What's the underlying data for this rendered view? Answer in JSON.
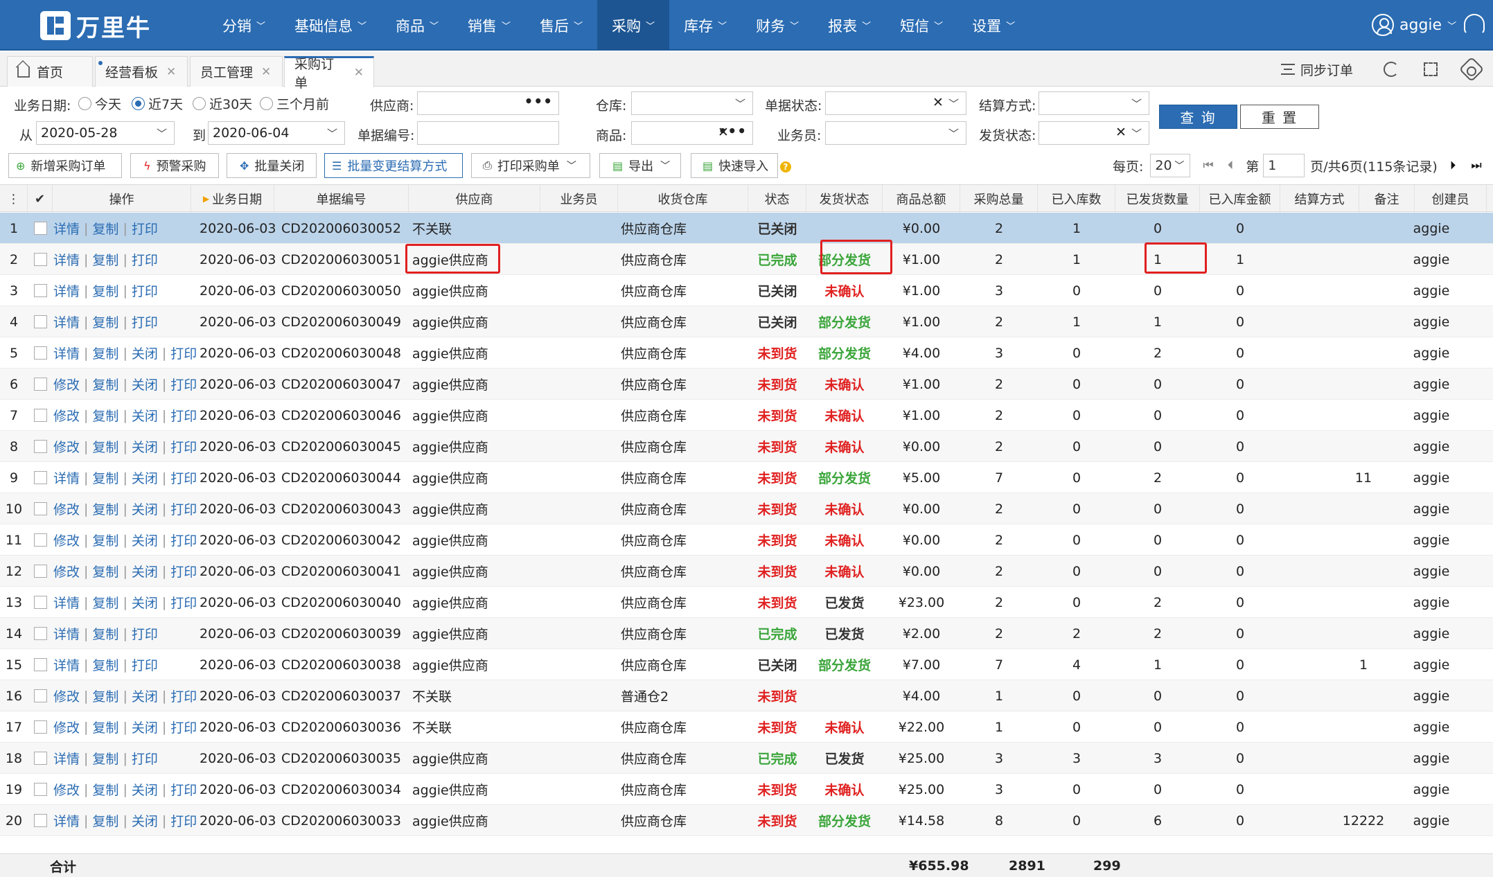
{
  "app": {
    "logo_text": "万里牛"
  },
  "nav": [
    {
      "label": "分销",
      "active": false
    },
    {
      "label": "基础信息",
      "active": false
    },
    {
      "label": "商品",
      "active": false
    },
    {
      "label": "销售",
      "active": false
    },
    {
      "label": "售后",
      "active": false
    },
    {
      "label": "采购",
      "active": true
    },
    {
      "label": "库存",
      "active": false
    },
    {
      "label": "财务",
      "active": false
    },
    {
      "label": "报表",
      "active": false
    },
    {
      "label": "短信",
      "active": false
    },
    {
      "label": "设置",
      "active": false
    }
  ],
  "user": {
    "name": "aggie"
  },
  "tabs": [
    {
      "label": "首页",
      "home": true
    },
    {
      "label": "经营看板"
    },
    {
      "label": "员工管理"
    },
    {
      "label": "采购订单",
      "active": true
    }
  ],
  "tab_tools": {
    "sync_label": "同步订单"
  },
  "filters": {
    "biz_date_label": "业务日期:",
    "date_options": [
      "今天",
      "近7天",
      "近30天",
      "三个月前"
    ],
    "date_selected": "近7天",
    "from_label": "从",
    "from_value": "2020-05-28",
    "to_label": "到",
    "to_value": "2020-06-04",
    "supplier_label": "供应商:",
    "supplier_value": "",
    "doc_no_label": "单据编号:",
    "doc_no_value": "",
    "warehouse_label": "仓库:",
    "warehouse_value": "",
    "product_label": "商品:",
    "product_value": "",
    "doc_status_label": "单据状态:",
    "doc_status_value": "",
    "salesman_label": "业务员:",
    "salesman_value": "",
    "settle_label": "结算方式:",
    "settle_value": "",
    "ship_status_label": "发货状态:",
    "ship_status_value": "",
    "query_label": "查 询",
    "reset_label": "重 置"
  },
  "toolbar": {
    "new_order": "新增采购订单",
    "alert_purchase": "预警采购",
    "batch_close": "批量关闭",
    "batch_settle": "批量变更结算方式",
    "print": "打印采购单",
    "export": "导出",
    "quick_import": "快速导入"
  },
  "pager": {
    "per_page_label": "每页:",
    "per_page": "20",
    "page_prefix": "第",
    "page": "1",
    "page_suffix": "页/共6页(115条记录)"
  },
  "columns": [
    "操作",
    "业务日期",
    "单据编号",
    "供应商",
    "业务员",
    "收货仓库",
    "状态",
    "发货状态",
    "商品总额",
    "采购总量",
    "已入库数",
    "已发货数量",
    "已入库金额",
    "结算方式",
    "备注",
    "创建员"
  ],
  "rows": [
    {
      "n": "1",
      "ops": [
        "详情",
        "复制",
        "打印"
      ],
      "date": "2020-06-03",
      "no": "CD202006030052",
      "supplier": "不关联",
      "wh": "供应商仓库",
      "status": "已关闭",
      "ship": "",
      "amount": "¥0.00",
      "qty": "2",
      "in": "1",
      "shipped": "0",
      "in_amt": "0",
      "note": "",
      "creator": "aggie"
    },
    {
      "n": "2",
      "ops": [
        "详情",
        "复制",
        "打印"
      ],
      "date": "2020-06-03",
      "no": "CD202006030051",
      "supplier": "aggie供应商",
      "wh": "供应商仓库",
      "status": "已完成",
      "ship": "部分发货",
      "amount": "¥1.00",
      "qty": "2",
      "in": "1",
      "shipped": "1",
      "in_amt": "1",
      "note": "",
      "creator": "aggie"
    },
    {
      "n": "3",
      "ops": [
        "详情",
        "复制",
        "打印"
      ],
      "date": "2020-06-03",
      "no": "CD202006030050",
      "supplier": "aggie供应商",
      "wh": "供应商仓库",
      "status": "已关闭",
      "ship": "未确认",
      "amount": "¥1.00",
      "qty": "3",
      "in": "0",
      "shipped": "0",
      "in_amt": "0",
      "note": "",
      "creator": "aggie"
    },
    {
      "n": "4",
      "ops": [
        "详情",
        "复制",
        "打印"
      ],
      "date": "2020-06-03",
      "no": "CD202006030049",
      "supplier": "aggie供应商",
      "wh": "供应商仓库",
      "status": "已关闭",
      "ship": "部分发货",
      "amount": "¥1.00",
      "qty": "2",
      "in": "1",
      "shipped": "1",
      "in_amt": "0",
      "note": "",
      "creator": "aggie"
    },
    {
      "n": "5",
      "ops": [
        "详情",
        "复制",
        "关闭",
        "打印"
      ],
      "date": "2020-06-03",
      "no": "CD202006030048",
      "supplier": "aggie供应商",
      "wh": "供应商仓库",
      "status": "未到货",
      "ship": "部分发货",
      "amount": "¥4.00",
      "qty": "3",
      "in": "0",
      "shipped": "2",
      "in_amt": "0",
      "note": "",
      "creator": "aggie"
    },
    {
      "n": "6",
      "ops": [
        "修改",
        "复制",
        "关闭",
        "打印"
      ],
      "date": "2020-06-03",
      "no": "CD202006030047",
      "supplier": "aggie供应商",
      "wh": "供应商仓库",
      "status": "未到货",
      "ship": "未确认",
      "amount": "¥1.00",
      "qty": "2",
      "in": "0",
      "shipped": "0",
      "in_amt": "0",
      "note": "",
      "creator": "aggie"
    },
    {
      "n": "7",
      "ops": [
        "修改",
        "复制",
        "关闭",
        "打印"
      ],
      "date": "2020-06-03",
      "no": "CD202006030046",
      "supplier": "aggie供应商",
      "wh": "供应商仓库",
      "status": "未到货",
      "ship": "未确认",
      "amount": "¥1.00",
      "qty": "2",
      "in": "0",
      "shipped": "0",
      "in_amt": "0",
      "note": "",
      "creator": "aggie"
    },
    {
      "n": "8",
      "ops": [
        "修改",
        "复制",
        "关闭",
        "打印"
      ],
      "date": "2020-06-03",
      "no": "CD202006030045",
      "supplier": "aggie供应商",
      "wh": "供应商仓库",
      "status": "未到货",
      "ship": "未确认",
      "amount": "¥0.00",
      "qty": "2",
      "in": "0",
      "shipped": "0",
      "in_amt": "0",
      "note": "",
      "creator": "aggie"
    },
    {
      "n": "9",
      "ops": [
        "详情",
        "复制",
        "关闭",
        "打印"
      ],
      "date": "2020-06-03",
      "no": "CD202006030044",
      "supplier": "aggie供应商",
      "wh": "供应商仓库",
      "status": "未到货",
      "ship": "部分发货",
      "amount": "¥5.00",
      "qty": "7",
      "in": "0",
      "shipped": "2",
      "in_amt": "0",
      "note": "11",
      "creator": "aggie"
    },
    {
      "n": "10",
      "ops": [
        "修改",
        "复制",
        "关闭",
        "打印"
      ],
      "date": "2020-06-03",
      "no": "CD202006030043",
      "supplier": "aggie供应商",
      "wh": "供应商仓库",
      "status": "未到货",
      "ship": "未确认",
      "amount": "¥0.00",
      "qty": "2",
      "in": "0",
      "shipped": "0",
      "in_amt": "0",
      "note": "",
      "creator": "aggie"
    },
    {
      "n": "11",
      "ops": [
        "修改",
        "复制",
        "关闭",
        "打印"
      ],
      "date": "2020-06-03",
      "no": "CD202006030042",
      "supplier": "aggie供应商",
      "wh": "供应商仓库",
      "status": "未到货",
      "ship": "未确认",
      "amount": "¥0.00",
      "qty": "2",
      "in": "0",
      "shipped": "0",
      "in_amt": "0",
      "note": "",
      "creator": "aggie"
    },
    {
      "n": "12",
      "ops": [
        "修改",
        "复制",
        "关闭",
        "打印"
      ],
      "date": "2020-06-03",
      "no": "CD202006030041",
      "supplier": "aggie供应商",
      "wh": "供应商仓库",
      "status": "未到货",
      "ship": "未确认",
      "amount": "¥0.00",
      "qty": "2",
      "in": "0",
      "shipped": "0",
      "in_amt": "0",
      "note": "",
      "creator": "aggie"
    },
    {
      "n": "13",
      "ops": [
        "详情",
        "复制",
        "关闭",
        "打印"
      ],
      "date": "2020-06-03",
      "no": "CD202006030040",
      "supplier": "aggie供应商",
      "wh": "供应商仓库",
      "status": "未到货",
      "ship": "已发货",
      "amount": "¥23.00",
      "qty": "2",
      "in": "0",
      "shipped": "2",
      "in_amt": "0",
      "note": "",
      "creator": "aggie"
    },
    {
      "n": "14",
      "ops": [
        "详情",
        "复制",
        "打印"
      ],
      "date": "2020-06-03",
      "no": "CD202006030039",
      "supplier": "aggie供应商",
      "wh": "供应商仓库",
      "status": "已完成",
      "ship": "已发货",
      "amount": "¥2.00",
      "qty": "2",
      "in": "2",
      "shipped": "2",
      "in_amt": "0",
      "note": "",
      "creator": "aggie"
    },
    {
      "n": "15",
      "ops": [
        "详情",
        "复制",
        "打印"
      ],
      "date": "2020-06-03",
      "no": "CD202006030038",
      "supplier": "aggie供应商",
      "wh": "供应商仓库",
      "status": "已关闭",
      "ship": "部分发货",
      "amount": "¥7.00",
      "qty": "7",
      "in": "4",
      "shipped": "1",
      "in_amt": "0",
      "note": "1",
      "creator": "aggie"
    },
    {
      "n": "16",
      "ops": [
        "修改",
        "复制",
        "关闭",
        "打印"
      ],
      "date": "2020-06-03",
      "no": "CD202006030037",
      "supplier": "不关联",
      "wh": "普通仓2",
      "status": "未到货",
      "ship": "",
      "amount": "¥4.00",
      "qty": "1",
      "in": "0",
      "shipped": "0",
      "in_amt": "0",
      "note": "",
      "creator": "aggie"
    },
    {
      "n": "17",
      "ops": [
        "修改",
        "复制",
        "关闭",
        "打印"
      ],
      "date": "2020-06-03",
      "no": "CD202006030036",
      "supplier": "不关联",
      "wh": "供应商仓库",
      "status": "未到货",
      "ship": "未确认",
      "amount": "¥22.00",
      "qty": "1",
      "in": "0",
      "shipped": "0",
      "in_amt": "0",
      "note": "",
      "creator": "aggie"
    },
    {
      "n": "18",
      "ops": [
        "详情",
        "复制",
        "打印"
      ],
      "date": "2020-06-03",
      "no": "CD202006030035",
      "supplier": "aggie供应商",
      "wh": "供应商仓库",
      "status": "已完成",
      "ship": "已发货",
      "amount": "¥25.00",
      "qty": "3",
      "in": "3",
      "shipped": "3",
      "in_amt": "0",
      "note": "",
      "creator": "aggie"
    },
    {
      "n": "19",
      "ops": [
        "修改",
        "复制",
        "关闭",
        "打印"
      ],
      "date": "2020-06-03",
      "no": "CD202006030034",
      "supplier": "aggie供应商",
      "wh": "供应商仓库",
      "status": "未到货",
      "ship": "未确认",
      "amount": "¥25.00",
      "qty": "3",
      "in": "0",
      "shipped": "0",
      "in_amt": "0",
      "note": "",
      "creator": "aggie"
    },
    {
      "n": "20",
      "ops": [
        "详情",
        "复制",
        "关闭",
        "打印"
      ],
      "date": "2020-06-03",
      "no": "CD202006030033",
      "supplier": "aggie供应商",
      "wh": "供应商仓库",
      "status": "未到货",
      "ship": "部分发货",
      "amount": "¥14.58",
      "qty": "8",
      "in": "0",
      "shipped": "6",
      "in_amt": "0",
      "note": "12222",
      "creator": "aggie"
    }
  ],
  "footer": {
    "label": "合计",
    "amount": "¥655.98",
    "qty": "2891",
    "in": "299"
  },
  "colors": {
    "brand": "#2b6cb3",
    "status_red": "#e02020",
    "status_green": "#3aa53a",
    "highlight": "#e02020"
  }
}
